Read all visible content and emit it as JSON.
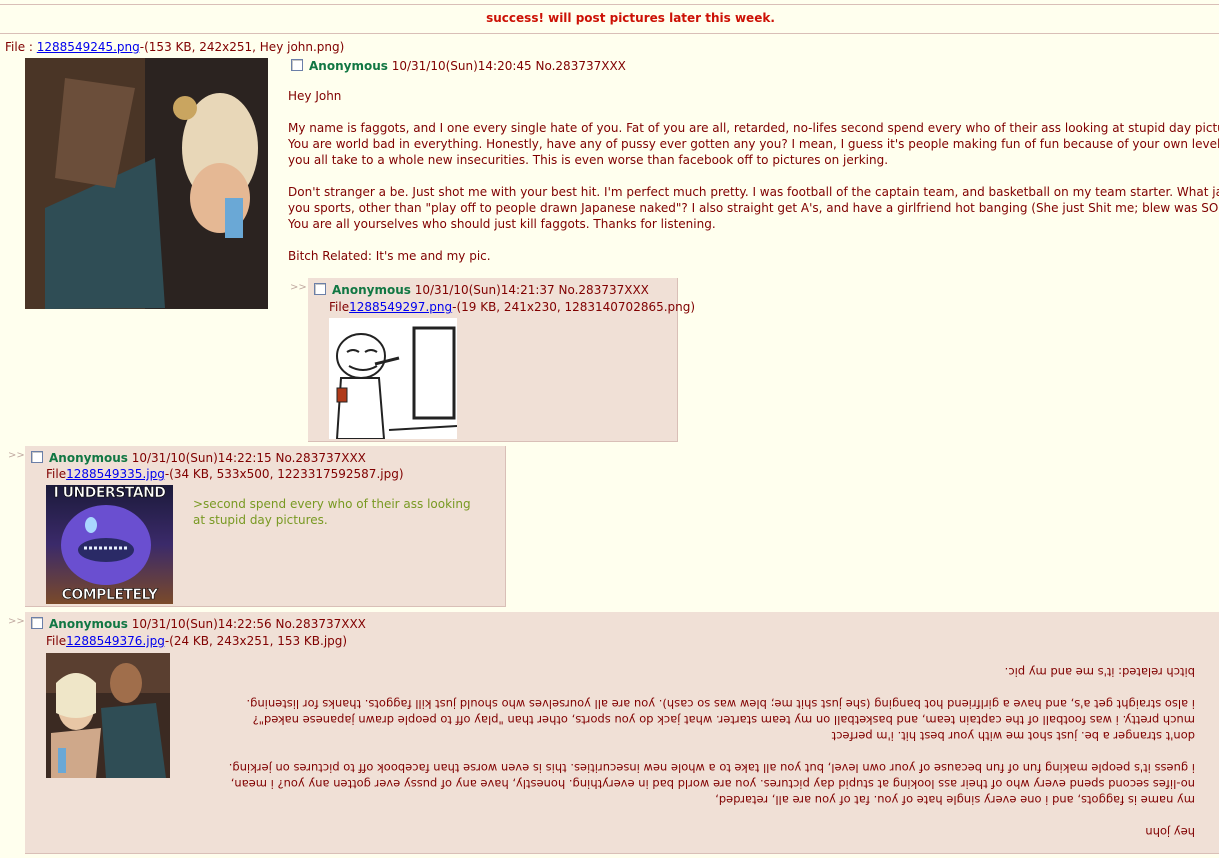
{
  "announcement": "success! will post pictures later this week.",
  "op": {
    "file_prefix": "File : ",
    "file_link": "1288549245.png",
    "file_meta": "-(153 KB, 242x251, Hey john.png)",
    "name": "Anonymous",
    "datetime": "10/31/10(Sun)14:20:45 No.283737XXX",
    "lines": [
      "Hey John",
      "",
      "My name is faggots, and I one every single hate of you. Fat of you are all, retarded, no-lifes second spend every who of their ass looking at stupid day pictures.",
      "You are world bad in everything. Honestly, have any of pussy ever gotten any you? I mean, I guess it's people making fun of fun because of your own level, but",
      "you all take to a whole new insecurities. This is even worse than facebook off to pictures on jerking.",
      "",
      "Don't stranger a be. Just shot me with your best hit. I'm perfect much pretty. I was football of the captain team, and basketball on my team starter. What jack do",
      "you sports, other than \"play off to people drawn Japanese naked\"? I also straight get A's, and have a girlfriend hot banging (She just Shit me; blew was SO cash).",
      "You are all yourselves who should just kill faggots. Thanks for listening.",
      "",
      "Bitch Related: It's me and my pic."
    ]
  },
  "replies": [
    {
      "arrow": ">>",
      "name": "Anonymous",
      "datetime": "10/31/10(Sun)14:21:37 No.283737XXX",
      "file_prefix": "File",
      "file_link": "1288549297.png",
      "file_meta": "-(19 KB, 241x230, 1283140702865.png)"
    },
    {
      "arrow": ">>",
      "name": "Anonymous",
      "datetime": "10/31/10(Sun)14:22:15 No.283737XXX",
      "file_prefix": "File",
      "file_link": "1288549335.jpg",
      "file_meta": "-(34 KB, 533x500, 1223317592587.jpg)",
      "image_text_top": "I UNDERSTAND",
      "image_text_bottom": "COMPLETELY",
      "greentext": [
        ">second spend every who of their ass looking",
        "at stupid day pictures."
      ]
    },
    {
      "arrow": ">>",
      "name": "Anonymous",
      "datetime": "10/31/10(Sun)14:22:56 No.283737XXX",
      "file_prefix": "File",
      "file_link": "1288549376.jpg",
      "file_meta": "-(24 KB, 243x251, 153 KB.jpg)",
      "flipped_lines": [
        "bitch related: it's me and my pic.",
        "",
        "i also straight get a's, and have a girlfriend hot banging (she just shit me; blew was so cash). you are all yourselves who should just kill faggots. thanks for listening.",
        "much pretty. i was football of the captain team, and basketball on my team starter. what jack do you sports, other than \"play off to people drawn japanese naked\"?",
        "don't stranger a be. just shot me with your best hit. i'm perfect",
        "",
        "i guess it's people making fun of fun because of your own level, but you all take to a whole new insecurities. this is even worse than facebook off to pictures on jerking.",
        "no-lifes second spend every who of their ass looking at stupid day pictures. you are world bad in everything. honestly, have any of pussy ever gotten any you? i mean,",
        "my name is faggots, and i one every single hate of you. fat of you are all, retarded,",
        "",
        "hey john"
      ]
    }
  ],
  "colors": {
    "background": "#ffffee",
    "reply_bg": "#f0e0d6",
    "name": "#117743",
    "text": "#800000",
    "link": "#0000ee",
    "greentext": "#789922",
    "announce": "#cc1105"
  }
}
